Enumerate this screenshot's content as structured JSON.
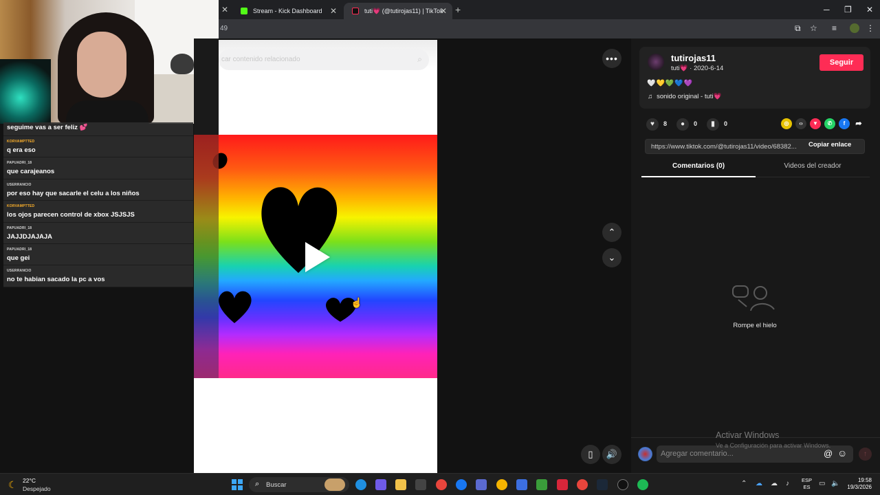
{
  "browser": {
    "prev_tab_close": "✕",
    "tabs": [
      {
        "title": "Stream - Kick Dashboard",
        "close": "✕"
      },
      {
        "title": "tuti💗 (@tutirojas11) | TikTok",
        "close": "✕"
      }
    ],
    "new_tab": "+",
    "window_controls": {
      "minimize": "─",
      "restore": "❐",
      "close": "✕"
    },
    "url_fragment": "49"
  },
  "chat": {
    "messages": [
      {
        "user": "",
        "text": "seguime vas a ser feliz",
        "emoji": "💕"
      },
      {
        "user": "KORVAMPTTED",
        "text": "q era eso",
        "color": "#ffb22b"
      },
      {
        "user": "PAPUADRI_18",
        "text": "que carajeanos",
        "color": "#d7d7d7"
      },
      {
        "user": "USERRANCIO",
        "text": "por eso hay que sacarle el celu a los niños",
        "color": "#d7d7d7"
      },
      {
        "user": "KORVAMPTTED",
        "text": "los ojos parecen control de xbox JSJSJS",
        "color": "#ffb22b"
      },
      {
        "user": "PAPUADRI_18",
        "text": "JAJJDJAJAJA",
        "color": "#d7d7d7"
      },
      {
        "user": "PAPUADRI_18",
        "text": "que gei",
        "color": "#d7d7d7"
      },
      {
        "user": "USERRANCIO",
        "text": "no te habian sacado la pc a vos",
        "color": "#d7d7d7"
      }
    ]
  },
  "tiktok": {
    "search_placeholder": "car contenido relacionado",
    "search_icon": "search-icon",
    "nav": {
      "more": "•••",
      "up": "⌃",
      "down": "⌄",
      "mini": "▯",
      "volume": "🔊"
    },
    "creator": {
      "username": "tutirojas11",
      "nickname_date": "tuti💗 · 2020-6-14",
      "follow_label": "Seguir",
      "description": "🤍💛💚💙💜",
      "sound": "sonido original - tuti💗"
    },
    "stats": {
      "likes": "8",
      "comments": "0",
      "saves": "0"
    },
    "share_icons": [
      "coin-icon",
      "embed-icon",
      "send-icon",
      "whatsapp-icon",
      "facebook-icon",
      "share-arrow-icon"
    ],
    "link": {
      "url": "https://www.tiktok.com/@tutirojas11/video/68382...",
      "copy_label": "Copiar enlace"
    },
    "tabs": {
      "comments": "Comentarios (0)",
      "creator_videos": "Videos del creador"
    },
    "empty_state": "Rompe el hielo",
    "comment_placeholder": "Agregar comentario...",
    "colors": {
      "accent": "#fe2c55"
    }
  },
  "watermark": {
    "line1": "Activar Windows",
    "line2": "Ve a Configuración para activar Windows."
  },
  "taskbar": {
    "temperature": "22°C",
    "condition": "Despejado",
    "search_label": "Buscar",
    "lang_top": "ESP",
    "lang_bottom": "ES",
    "time": "19:58",
    "date": "19/3/2026"
  }
}
